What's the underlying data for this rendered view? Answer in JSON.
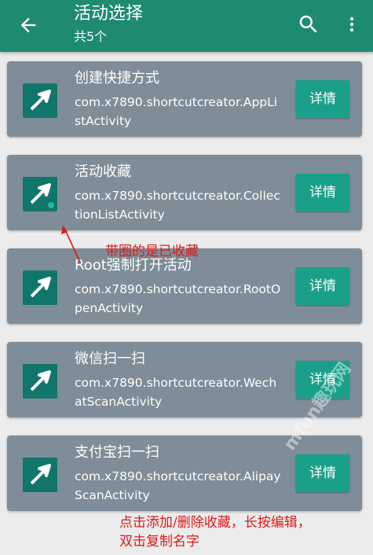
{
  "appbar": {
    "title": "活动选择",
    "subtitle": "共5个",
    "icons": {
      "back": "arrow-back-icon",
      "search": "search-icon",
      "more": "more-vert-icon"
    }
  },
  "activities": [
    {
      "name": "创建快捷方式",
      "package": "com.x7890.shortcutcreator.AppListActivity",
      "detail_label": "详情",
      "favorited": false
    },
    {
      "name": "活动收藏",
      "package": "com.x7890.shortcutcreator.CollectionListActivity",
      "detail_label": "详情",
      "favorited": true
    },
    {
      "name": "Root强制打开活动",
      "package": "com.x7890.shortcutcreator.RootOpenActivity",
      "detail_label": "详情",
      "favorited": false
    },
    {
      "name": "微信扫一扫",
      "package": "com.x7890.shortcutcreator.WechatScanActivity",
      "detail_label": "详情",
      "favorited": false
    },
    {
      "name": "支付宝扫一扫",
      "package": "com.x7890.shortcutcreator.AlipayScanActivity",
      "detail_label": "详情",
      "favorited": false
    }
  ],
  "annotations": {
    "favorite_note": "带圈的是已收藏",
    "usage_note_line1": "点击添加/删除收藏，长按编辑，",
    "usage_note_line2": "双击复制名字"
  },
  "watermark": "mfun趣玩网",
  "colors": {
    "appbar": "#1e8a72",
    "card": "#7e8d98",
    "button": "#1aa089",
    "icon_bg": "#11766a",
    "note": "#e0181a"
  }
}
